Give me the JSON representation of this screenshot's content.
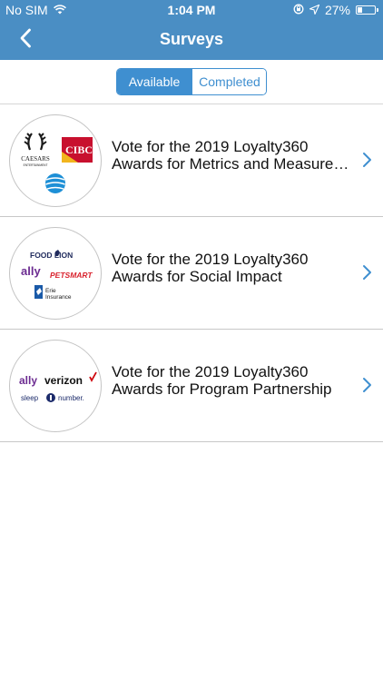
{
  "status_bar": {
    "carrier": "No SIM",
    "time": "1:04 PM",
    "battery_percent_label": "27%",
    "battery_level": 0.27
  },
  "nav": {
    "title": "Surveys"
  },
  "segments": {
    "available_label": "Available",
    "completed_label": "Completed",
    "selected": "Available"
  },
  "surveys": [
    {
      "title_line1": "Vote for the 2019 Loyalty360",
      "title_line2": "Awards for Metrics and Measurement",
      "logos": [
        "CAESARS ENTERTAINMENT",
        "CIBC",
        "AT&T"
      ]
    },
    {
      "title_line1": "Vote for the 2019 Loyalty360",
      "title_line2": "Awards for Social Impact",
      "logos": [
        "FOOD LION",
        "ally",
        "PETSMART",
        "Erie Insurance"
      ]
    },
    {
      "title_line1": "Vote for the 2019 Loyalty360",
      "title_line2": "Awards for Program Partnership",
      "logos": [
        "ally",
        "verizon",
        "sleep number"
      ]
    }
  ],
  "logo_text": {
    "caesars": "CAESARS",
    "caesars_sub": "ENTERTAINMENT",
    "cibc": "CIBC",
    "food_lion": "FOOD LION",
    "ally": "ally",
    "petsmart": "PETSMART",
    "erie": "Erie",
    "erie_sub": "Insurance",
    "verizon": "verizon",
    "sleep": "sleep",
    "number": "number."
  },
  "colors": {
    "header": "#4a8ec4",
    "accent": "#3f8fd0",
    "cibc_red": "#c8102e",
    "cibc_gold": "#f2b51e",
    "att_blue": "#1d8fd6",
    "food_lion_navy": "#1f2a5c",
    "ally_purple": "#6c2c91",
    "petsmart_red": "#d9232e",
    "erie_blue": "#1a5aa8",
    "verizon_red": "#cd040b",
    "sleep_number_navy": "#1c2b6b"
  }
}
